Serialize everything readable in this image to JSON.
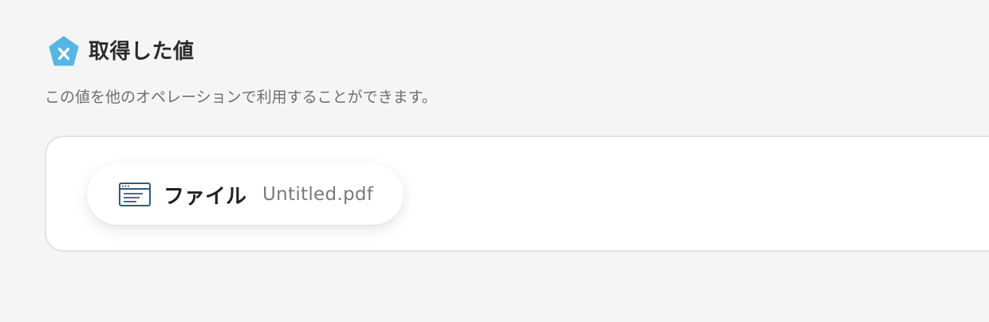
{
  "section": {
    "icon": "pentagon-x-badge-icon",
    "title": "取得した値",
    "description": "この値を他のオペレーションで利用することができます。"
  },
  "output": {
    "chip": {
      "icon": "file-window-icon",
      "label": "ファイル",
      "value": "Untitled.pdf"
    }
  },
  "colors": {
    "badge": "#56b6e4",
    "file_icon": "#2f5c78",
    "panel_border": "#e2e2e2",
    "background": "#f5f5f5"
  }
}
